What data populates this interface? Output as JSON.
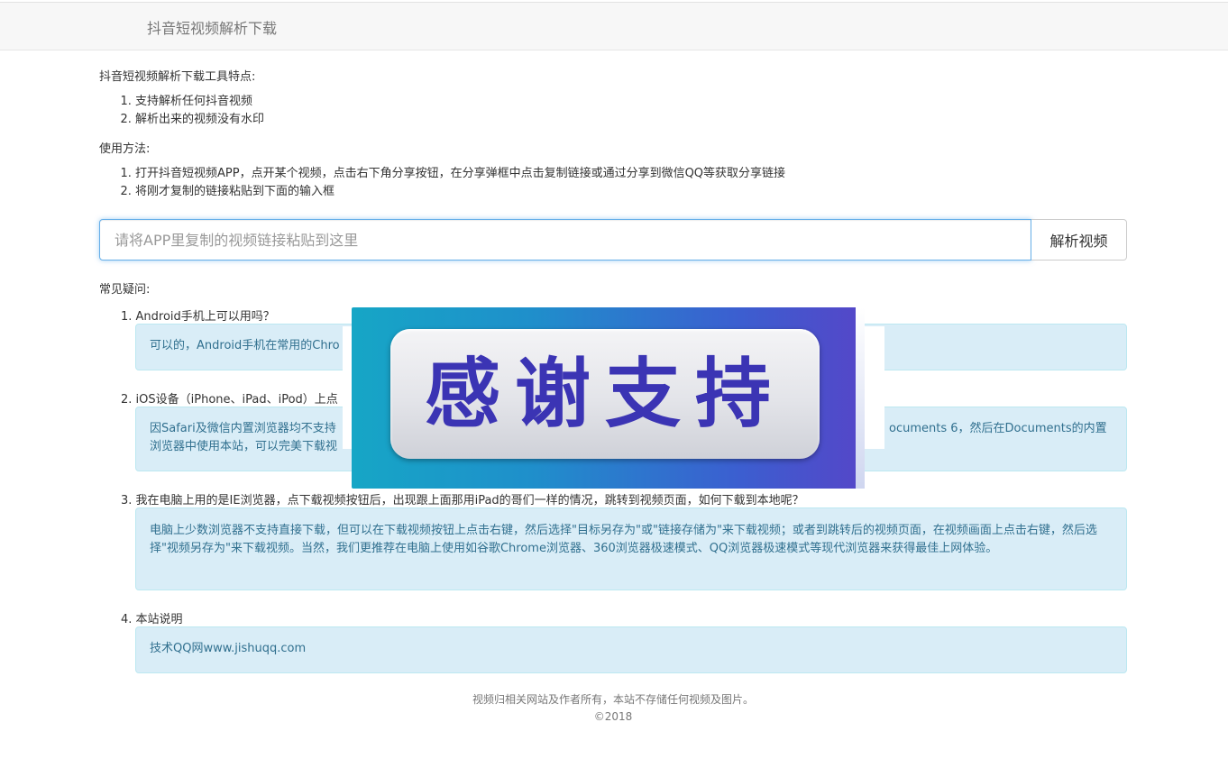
{
  "brand": "抖音短视频解析下载",
  "features": {
    "heading": "抖音短视频解析下载工具特点:",
    "items": [
      "支持解析任何抖音视频",
      "解析出来的视频没有水印"
    ]
  },
  "usage": {
    "heading": "使用方法:",
    "items": [
      "打开抖音短视频APP，点开某个视频，点击右下角分享按钮，在分享弹框中点击复制链接或通过分享到微信QQ等获取分享链接",
      "将刚才复制的链接粘贴到下面的输入框"
    ]
  },
  "search": {
    "placeholder": "请将APP里复制的视频链接粘贴到这里",
    "button": "解析视频"
  },
  "faq": {
    "heading": "常见疑问:",
    "items": [
      {
        "q": "1. Android手机上可以用吗？",
        "a": "可以的，Android手机在常用的Chro"
      },
      {
        "q": "2. iOS设备（iPhone、iPad、iPod）上点",
        "a1": "因Safari及微信内置浏览器均不支持",
        "a1_right": "ocuments 6，然后在Documents的内置",
        "a2": "浏览器中使用本站，可以完美下载视"
      },
      {
        "q": "3. 我在电脑上用的是IE浏览器，点下载视频按钮后，出现跟上面那用iPad的哥们一样的情况，跳转到视频页面，如何下载到本地呢？",
        "a": "电脑上少数浏览器不支持直接下载，但可以在下载视频按钮上点击右键，然后选择\"目标另存为\"或\"链接存储为\"来下载视频；或者到跳转后的视频页面，在视频画面上点击右键，然后选择\"视频另存为\"来下载视频。当然，我们更推荐在电脑上使用如谷歌Chrome浏览器、360浏览器极速模式、QQ浏览器极速模式等现代浏览器来获得最佳上网体验。"
      },
      {
        "q": "4. 本站说明",
        "a": "技术QQ网www.jishuqq.com"
      }
    ]
  },
  "footer": {
    "line1": "视频归相关网站及作者所有，本站不存储任何视频及图片。",
    "line2": "©2018"
  },
  "overlay": {
    "text": "感谢支持"
  }
}
